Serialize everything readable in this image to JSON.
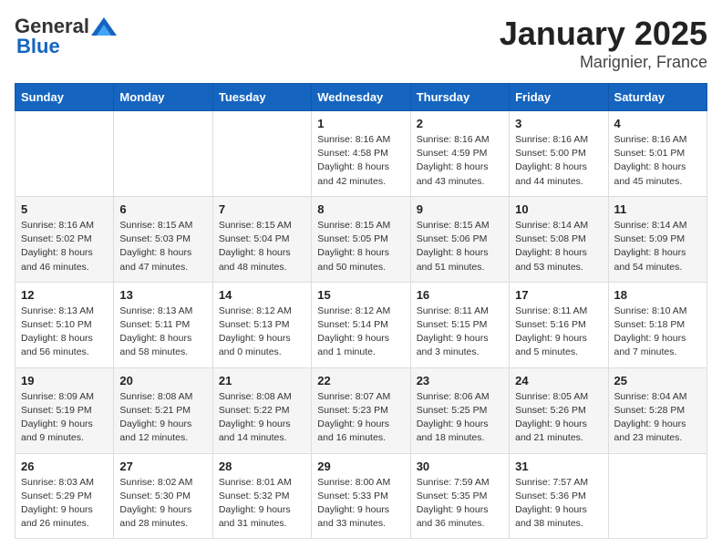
{
  "logo": {
    "general": "General",
    "blue": "Blue"
  },
  "title": "January 2025",
  "subtitle": "Marignier, France",
  "days_of_week": [
    "Sunday",
    "Monday",
    "Tuesday",
    "Wednesday",
    "Thursday",
    "Friday",
    "Saturday"
  ],
  "weeks": [
    [
      {
        "day": "",
        "info": ""
      },
      {
        "day": "",
        "info": ""
      },
      {
        "day": "",
        "info": ""
      },
      {
        "day": "1",
        "info": "Sunrise: 8:16 AM\nSunset: 4:58 PM\nDaylight: 8 hours\nand 42 minutes."
      },
      {
        "day": "2",
        "info": "Sunrise: 8:16 AM\nSunset: 4:59 PM\nDaylight: 8 hours\nand 43 minutes."
      },
      {
        "day": "3",
        "info": "Sunrise: 8:16 AM\nSunset: 5:00 PM\nDaylight: 8 hours\nand 44 minutes."
      },
      {
        "day": "4",
        "info": "Sunrise: 8:16 AM\nSunset: 5:01 PM\nDaylight: 8 hours\nand 45 minutes."
      }
    ],
    [
      {
        "day": "5",
        "info": "Sunrise: 8:16 AM\nSunset: 5:02 PM\nDaylight: 8 hours\nand 46 minutes."
      },
      {
        "day": "6",
        "info": "Sunrise: 8:15 AM\nSunset: 5:03 PM\nDaylight: 8 hours\nand 47 minutes."
      },
      {
        "day": "7",
        "info": "Sunrise: 8:15 AM\nSunset: 5:04 PM\nDaylight: 8 hours\nand 48 minutes."
      },
      {
        "day": "8",
        "info": "Sunrise: 8:15 AM\nSunset: 5:05 PM\nDaylight: 8 hours\nand 50 minutes."
      },
      {
        "day": "9",
        "info": "Sunrise: 8:15 AM\nSunset: 5:06 PM\nDaylight: 8 hours\nand 51 minutes."
      },
      {
        "day": "10",
        "info": "Sunrise: 8:14 AM\nSunset: 5:08 PM\nDaylight: 8 hours\nand 53 minutes."
      },
      {
        "day": "11",
        "info": "Sunrise: 8:14 AM\nSunset: 5:09 PM\nDaylight: 8 hours\nand 54 minutes."
      }
    ],
    [
      {
        "day": "12",
        "info": "Sunrise: 8:13 AM\nSunset: 5:10 PM\nDaylight: 8 hours\nand 56 minutes."
      },
      {
        "day": "13",
        "info": "Sunrise: 8:13 AM\nSunset: 5:11 PM\nDaylight: 8 hours\nand 58 minutes."
      },
      {
        "day": "14",
        "info": "Sunrise: 8:12 AM\nSunset: 5:13 PM\nDaylight: 9 hours\nand 0 minutes."
      },
      {
        "day": "15",
        "info": "Sunrise: 8:12 AM\nSunset: 5:14 PM\nDaylight: 9 hours\nand 1 minute."
      },
      {
        "day": "16",
        "info": "Sunrise: 8:11 AM\nSunset: 5:15 PM\nDaylight: 9 hours\nand 3 minutes."
      },
      {
        "day": "17",
        "info": "Sunrise: 8:11 AM\nSunset: 5:16 PM\nDaylight: 9 hours\nand 5 minutes."
      },
      {
        "day": "18",
        "info": "Sunrise: 8:10 AM\nSunset: 5:18 PM\nDaylight: 9 hours\nand 7 minutes."
      }
    ],
    [
      {
        "day": "19",
        "info": "Sunrise: 8:09 AM\nSunset: 5:19 PM\nDaylight: 9 hours\nand 9 minutes."
      },
      {
        "day": "20",
        "info": "Sunrise: 8:08 AM\nSunset: 5:21 PM\nDaylight: 9 hours\nand 12 minutes."
      },
      {
        "day": "21",
        "info": "Sunrise: 8:08 AM\nSunset: 5:22 PM\nDaylight: 9 hours\nand 14 minutes."
      },
      {
        "day": "22",
        "info": "Sunrise: 8:07 AM\nSunset: 5:23 PM\nDaylight: 9 hours\nand 16 minutes."
      },
      {
        "day": "23",
        "info": "Sunrise: 8:06 AM\nSunset: 5:25 PM\nDaylight: 9 hours\nand 18 minutes."
      },
      {
        "day": "24",
        "info": "Sunrise: 8:05 AM\nSunset: 5:26 PM\nDaylight: 9 hours\nand 21 minutes."
      },
      {
        "day": "25",
        "info": "Sunrise: 8:04 AM\nSunset: 5:28 PM\nDaylight: 9 hours\nand 23 minutes."
      }
    ],
    [
      {
        "day": "26",
        "info": "Sunrise: 8:03 AM\nSunset: 5:29 PM\nDaylight: 9 hours\nand 26 minutes."
      },
      {
        "day": "27",
        "info": "Sunrise: 8:02 AM\nSunset: 5:30 PM\nDaylight: 9 hours\nand 28 minutes."
      },
      {
        "day": "28",
        "info": "Sunrise: 8:01 AM\nSunset: 5:32 PM\nDaylight: 9 hours\nand 31 minutes."
      },
      {
        "day": "29",
        "info": "Sunrise: 8:00 AM\nSunset: 5:33 PM\nDaylight: 9 hours\nand 33 minutes."
      },
      {
        "day": "30",
        "info": "Sunrise: 7:59 AM\nSunset: 5:35 PM\nDaylight: 9 hours\nand 36 minutes."
      },
      {
        "day": "31",
        "info": "Sunrise: 7:57 AM\nSunset: 5:36 PM\nDaylight: 9 hours\nand 38 minutes."
      },
      {
        "day": "",
        "info": ""
      }
    ]
  ]
}
